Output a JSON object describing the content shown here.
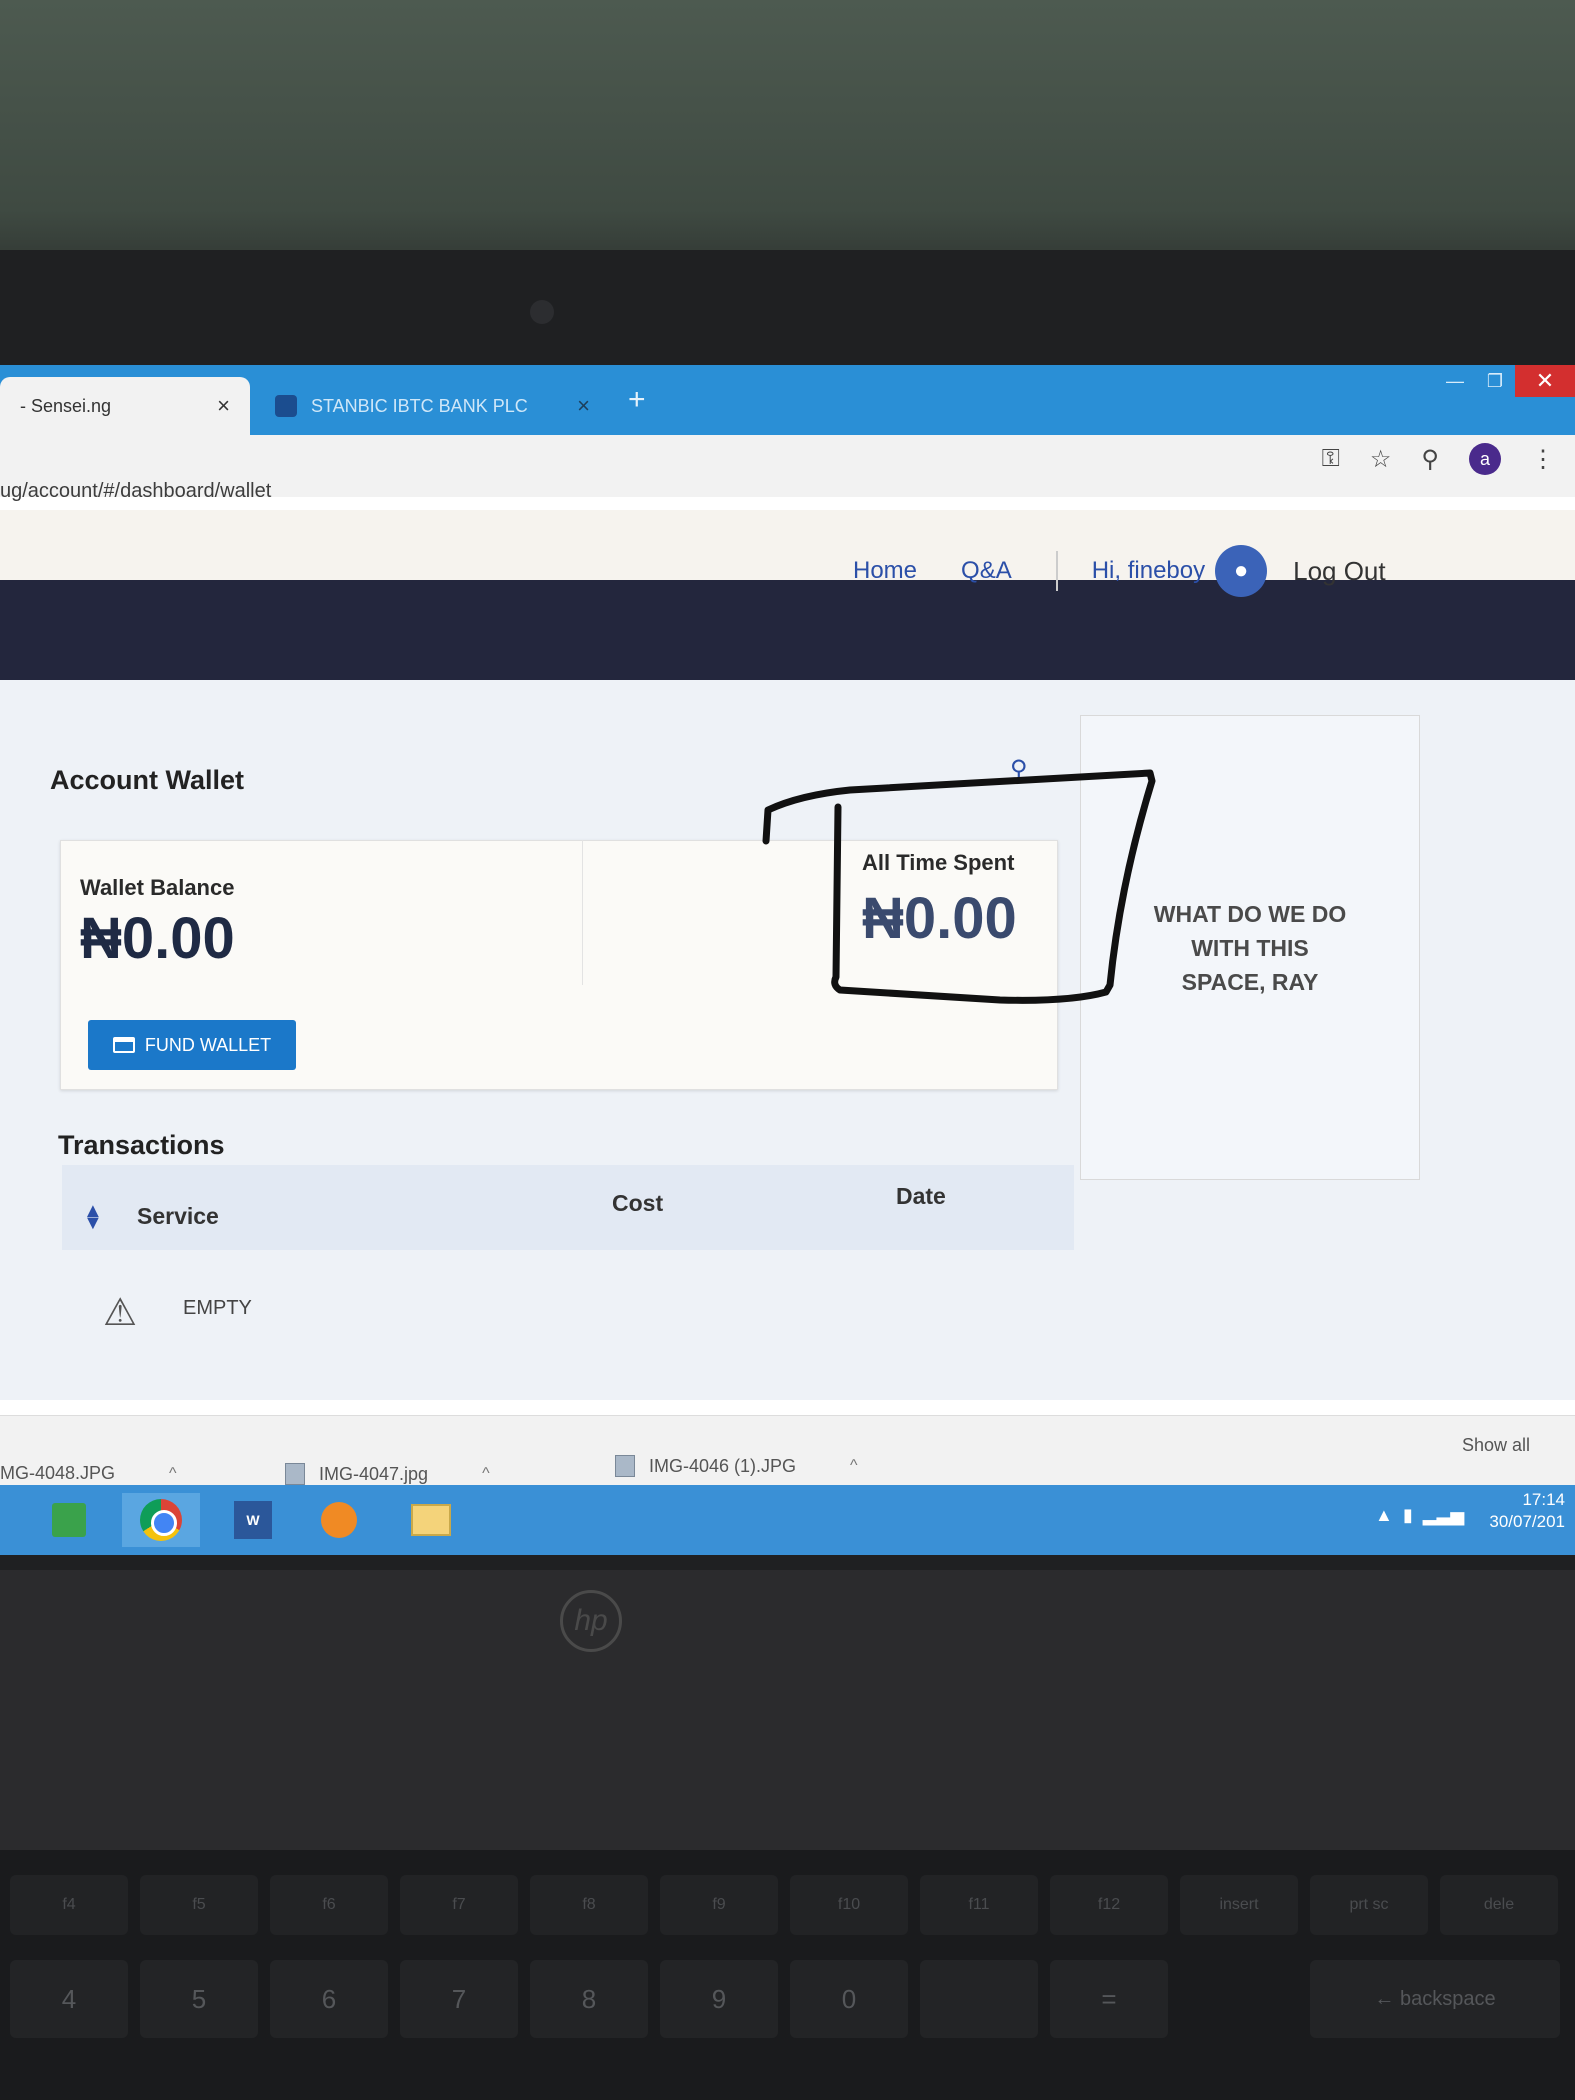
{
  "browser": {
    "tabs": [
      {
        "title": "- Sensei.ng",
        "active": true
      },
      {
        "title": "STANBIC IBTC BANK PLC",
        "active": false
      }
    ],
    "new_tab_symbol": "+",
    "close_symbol": "×",
    "url": "ug/account/#/dashboard/wallet",
    "profile_initial": "a"
  },
  "site_nav": {
    "home": "Home",
    "qa": "Q&A",
    "greeting": "Hi, fineboy",
    "logout": "Log Out"
  },
  "wallet": {
    "heading": "Account Wallet",
    "balance_label": "Wallet Balance",
    "balance_value": "₦0.00",
    "spent_label": "All Time Spent",
    "spent_value": "₦0.00",
    "fund_button": "FUND WALLET",
    "side_note": "WHAT DO WE DO WITH THIS SPACE, RAY"
  },
  "transactions": {
    "heading": "Transactions",
    "columns": [
      "Service",
      "Cost",
      "Date"
    ],
    "empty_label": "EMPTY"
  },
  "downloads": {
    "files": [
      "MG-4048.JPG",
      "IMG-4047.jpg",
      "IMG-4046 (1).JPG"
    ],
    "show_all": "Show all"
  },
  "taskbar": {
    "time": "17:14",
    "date": "30/07/201"
  },
  "device": {
    "brand": "hp",
    "function_keys": [
      "f4",
      "f5",
      "f6",
      "f7",
      "f8",
      "f9",
      "f10",
      "f11",
      "f12",
      "insert",
      "prt sc",
      "dele"
    ],
    "number_keys": [
      "4",
      "5",
      "6",
      "7",
      "8",
      "9",
      "0",
      "",
      "=",
      "← backspace"
    ]
  },
  "colors": {
    "accent": "#1b78c9",
    "nav_text": "#2b4fa8",
    "band": "#23263d",
    "taskbar": "#3a90d6"
  }
}
